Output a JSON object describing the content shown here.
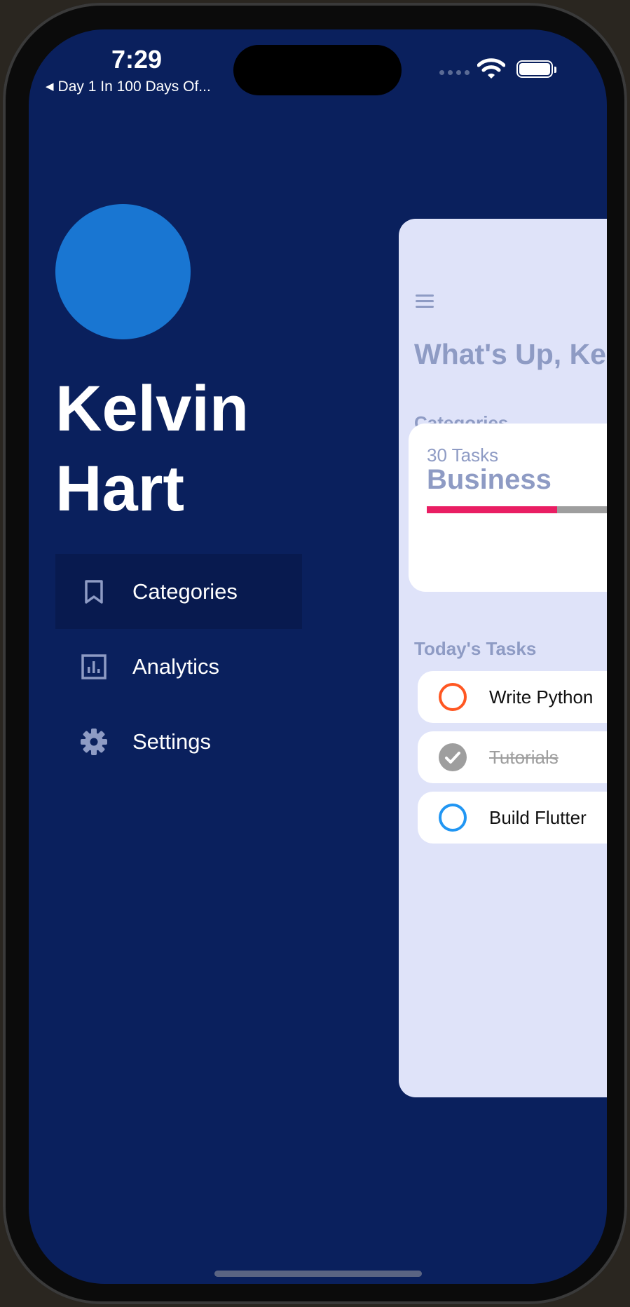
{
  "status_bar": {
    "time": "7:29",
    "back_label": "Day 1 In 100 Days Of...",
    "back_arrow": "◀"
  },
  "profile": {
    "first_name": "Kelvin",
    "last_name": "Hart",
    "avatar_color": "#1976d2"
  },
  "drawer": {
    "items": [
      {
        "label": "Categories",
        "icon": "bookmark-icon",
        "active": true
      },
      {
        "label": "Analytics",
        "icon": "analytics-icon",
        "active": false
      },
      {
        "label": "Settings",
        "icon": "gear-icon",
        "active": false
      }
    ]
  },
  "main": {
    "greeting": "What's Up, Ke",
    "categories_heading": "Categories",
    "category_card": {
      "tasks_label": "30 Tasks",
      "name": "Business",
      "progress": 0.58,
      "progress_color": "#e91e63"
    },
    "todays_tasks_heading": "Today's Tasks",
    "tasks": [
      {
        "label": "Write Python",
        "done": false,
        "color": "#ff5722"
      },
      {
        "label": "Tutorials",
        "done": true,
        "color": "#9e9e9e"
      },
      {
        "label": "Build Flutter",
        "done": false,
        "color": "#2196f3"
      }
    ]
  },
  "colors": {
    "drawer_background": "#0a205d",
    "panel_background": "#dfe3f9",
    "muted_text": "#8e9bc4"
  }
}
